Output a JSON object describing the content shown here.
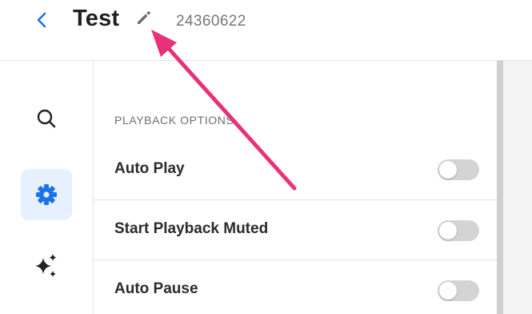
{
  "header": {
    "title": "Test",
    "id": "24360622",
    "back_icon": "chevron-left-icon",
    "edit_icon": "pencil-icon"
  },
  "sidebar": {
    "items": [
      {
        "name": "search",
        "icon": "search-icon",
        "active": false
      },
      {
        "name": "settings",
        "icon": "gear-icon",
        "active": true
      },
      {
        "name": "ai",
        "icon": "sparkles-icon",
        "active": false
      }
    ]
  },
  "playback": {
    "section_title": "PLAYBACK OPTIONS",
    "options": [
      {
        "label": "Auto Play",
        "enabled": false
      },
      {
        "label": "Start Playback Muted",
        "enabled": false
      },
      {
        "label": "Auto Pause",
        "enabled": false
      }
    ]
  },
  "colors": {
    "accent": "#1a73e8",
    "active_bg": "#e6f0ff",
    "annotation": "#e8317a",
    "toggle_off": "#d4d4d4"
  }
}
